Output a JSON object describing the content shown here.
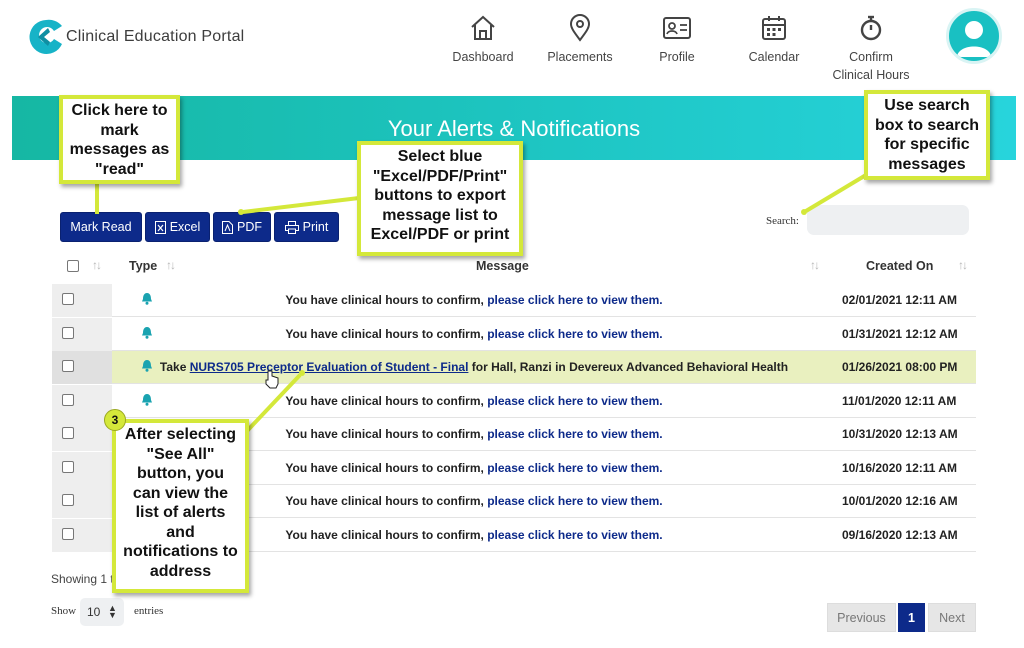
{
  "app": {
    "brand": "Clinical Education Portal"
  },
  "nav": {
    "dashboard": "Dashboard",
    "placements": "Placements",
    "profile": "Profile",
    "calendar": "Calendar",
    "confirm_line1": "Confirm",
    "confirm_line2": "Clinical Hours"
  },
  "banner": {
    "title": "Your Alerts & Notifications"
  },
  "toolbar": {
    "mark_read": "Mark Read",
    "excel": "Excel",
    "pdf": "PDF",
    "print": "Print",
    "search_label": "Search:",
    "search_value": ""
  },
  "table": {
    "headers": {
      "type": "Type",
      "message": "Message",
      "created_on": "Created On"
    },
    "rows": [
      {
        "msg_text": "You have clinical hours to confirm, ",
        "msg_link": "please click here to view them.",
        "date": "02/01/2021 12:11 AM"
      },
      {
        "msg_text": "You have clinical hours to confirm, ",
        "msg_link": "please click here to view them.",
        "date": "01/31/2021 12:12 AM"
      },
      {
        "msg_pre": "Take ",
        "msg_link": "NURS705 Preceptor Evaluation of Student - Final",
        "msg_post": " for Hall, Ranzi in Devereux Advanced Behavioral Health",
        "date": "01/26/2021 08:00 PM"
      },
      {
        "msg_text": "You have clinical hours to confirm, ",
        "msg_link": "please click here to view them.",
        "date": "11/01/2020 12:11 AM"
      },
      {
        "msg_text": "You have clinical hours to confirm, ",
        "msg_link": "please click here to view them.",
        "date": "10/31/2020 12:13 AM"
      },
      {
        "msg_text": "You have clinical hours to confirm, ",
        "msg_link": "please click here to view them.",
        "date": "10/16/2020 12:11 AM"
      },
      {
        "msg_text": "You have clinical hours to confirm, ",
        "msg_link": "please click here to view them.",
        "date": "10/01/2020 12:16 AM"
      },
      {
        "msg_text": "You have clinical hours to confirm, ",
        "msg_link": "please click here to view them.",
        "date": "09/16/2020 12:13 AM"
      }
    ]
  },
  "footer": {
    "showing": "Showing 1 t",
    "show_label": "Show",
    "page_length": "10",
    "entries_label": "entries",
    "prev": "Previous",
    "page": "1",
    "next": "Next"
  },
  "callouts": {
    "mark_read": [
      "Click here to",
      "mark",
      "messages as",
      "\"read\""
    ],
    "export": [
      "Select blue",
      "\"Excel/PDF/Print\"",
      "buttons to export",
      "message list to",
      "Excel/PDF or print"
    ],
    "search": [
      "Use search",
      "box to search",
      "for specific",
      "messages"
    ],
    "see_all": [
      "After selecting",
      "\"See All\"",
      "button, you",
      "can view the",
      "list of alerts",
      "and",
      "notifications to",
      "address"
    ],
    "step_number": "3"
  },
  "colors": {
    "primary": "#0d2a8a",
    "banner_start": "#16b7a3",
    "banner_end": "#27d4dc",
    "callout_border": "#d4e83a",
    "highlight_row": "#e9f0bf"
  }
}
